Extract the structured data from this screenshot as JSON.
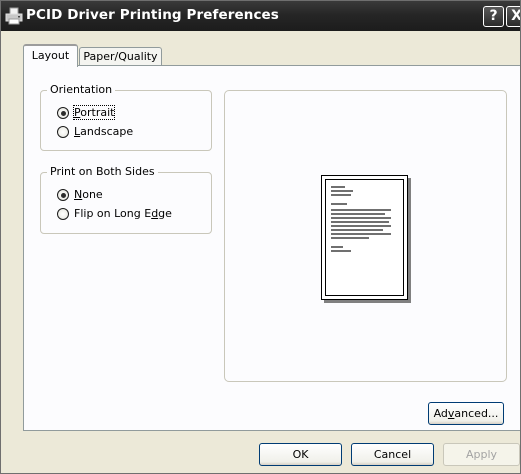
{
  "window": {
    "title": "PCID Driver Printing Preferences",
    "help_glyph": "?",
    "close_glyph": "X"
  },
  "tabs": [
    {
      "label": "Layout",
      "selected": true
    },
    {
      "label": "Paper/Quality",
      "selected": false
    }
  ],
  "orientation": {
    "legend": "Orientation",
    "options": [
      {
        "pre": "",
        "key": "P",
        "post": "ortrait",
        "checked": true
      },
      {
        "pre": "",
        "key": "L",
        "post": "andscape",
        "checked": false
      }
    ]
  },
  "duplex": {
    "legend": "Print on Both Sides",
    "options": [
      {
        "pre": "",
        "key": "N",
        "post": "one",
        "checked": true
      },
      {
        "pre": "Flip on Long E",
        "key": "d",
        "post": "ge",
        "checked": false
      }
    ]
  },
  "advanced_button": {
    "pre": "Ad",
    "key": "v",
    "post": "anced..."
  },
  "buttons": {
    "ok": "OK",
    "cancel": "Cancel",
    "apply": "Apply"
  },
  "icons": {
    "app": "printer-icon",
    "help": "help-icon",
    "close": "close-icon"
  },
  "colors": {
    "dialog_bg": "#ece9d8",
    "titlebar": "#262626",
    "panel_bg": "#fcfcfe",
    "button_border": "#003c74"
  }
}
